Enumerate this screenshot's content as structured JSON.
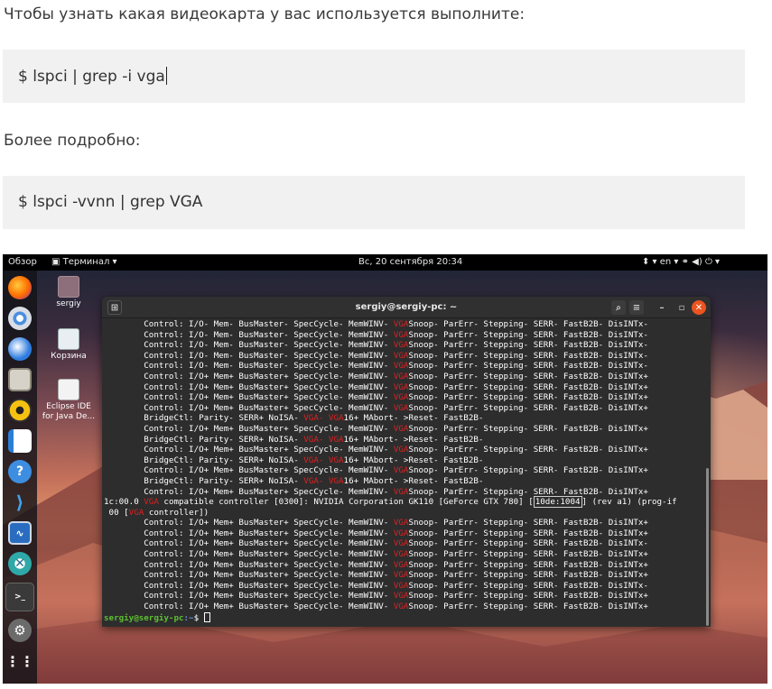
{
  "article": {
    "para1": "Чтобы узнать какая видеокарта у вас используется выполните:",
    "code1": "$  lspci | grep -i vga",
    "para2": "Более подробно:",
    "code2": "$ lspci -vvnn | grep VGA"
  },
  "topbar": {
    "overview": "Обзор",
    "app_menu": "▣ Терминал ▾",
    "clock": "Вс, 20 сентября  20:34",
    "status": "⬍ ▾     en ▾    ⚭  ◀)  ⏻ ▾"
  },
  "desktop": {
    "icons": [
      {
        "label": "sergiy",
        "icon": "home-folder-icon"
      },
      {
        "label": "Корзина",
        "icon": "trash-icon"
      },
      {
        "label": "Eclipse IDE for Java De...",
        "icon": "eclipse-launcher-icon"
      }
    ]
  },
  "dock": {
    "apps": [
      "firefox-icon",
      "chromium-icon",
      "thunderbird-icon",
      "files-icon",
      "rhythmbox-icon",
      "libreoffice-writer-icon",
      "help-icon",
      "vscode-icon",
      "system-monitor-icon",
      "remmina-icon",
      "terminal-icon",
      "settings-icon",
      "show-applications-icon"
    ]
  },
  "terminal": {
    "title": "sergiy@sergiy-pc: ~",
    "lines": [
      {
        "pre": "        Control: I/O- Mem- BusMaster- SpecCycle- MemWINV- ",
        "vga": "VGA",
        "post": "Snoop- ParErr- Stepping- SERR- FastB2B- DisINTx-"
      },
      {
        "pre": "        Control: I/O- Mem- BusMaster- SpecCycle- MemWINV- ",
        "vga": "VGA",
        "post": "Snoop- ParErr- Stepping- SERR- FastB2B- DisINTx-"
      },
      {
        "pre": "        Control: I/O- Mem- BusMaster- SpecCycle- MemWINV- ",
        "vga": "VGA",
        "post": "Snoop- ParErr- Stepping- SERR- FastB2B- DisINTx-"
      },
      {
        "pre": "        Control: I/O- Mem- BusMaster- SpecCycle- MemWINV- ",
        "vga": "VGA",
        "post": "Snoop- ParErr- Stepping- SERR- FastB2B- DisINTx-"
      },
      {
        "pre": "        Control: I/O- Mem- BusMaster- SpecCycle- MemWINV- ",
        "vga": "VGA",
        "post": "Snoop- ParErr- Stepping- SERR- FastB2B- DisINTx-"
      },
      {
        "pre": "        Control: I/O+ Mem+ BusMaster+ SpecCycle- MemWINV- ",
        "vga": "VGA",
        "post": "Snoop- ParErr- Stepping- SERR- FastB2B- DisINTx+"
      },
      {
        "pre": "        Control: I/O+ Mem+ BusMaster+ SpecCycle- MemWINV- ",
        "vga": "VGA",
        "post": "Snoop- ParErr- Stepping- SERR- FastB2B- DisINTx+"
      },
      {
        "pre": "        Control: I/O+ Mem+ BusMaster+ SpecCycle- MemWINV- ",
        "vga": "VGA",
        "post": "Snoop- ParErr- Stepping- SERR- FastB2B- DisINTx+"
      },
      {
        "pre": "        Control: I/O+ Mem+ BusMaster+ SpecCycle- MemWINV- ",
        "vga": "VGA",
        "post": "Snoop- ParErr- Stepping- SERR- FastB2B- DisINTx+"
      },
      {
        "pre": "        BridgeCtl: Parity- SERR+ NoISA- ",
        "vga": "VGA- VGA",
        "post": "16+ MAbort- >Reset- FastB2B-"
      },
      {
        "pre": "        Control: I/O+ Mem+ BusMaster+ SpecCycle- MemWINV- ",
        "vga": "VGA",
        "post": "Snoop- ParErr- Stepping- SERR- FastB2B- DisINTx+"
      },
      {
        "pre": "        BridgeCtl: Parity- SERR+ NoISA- ",
        "vga": "VGA- VGA",
        "post": "16+ MAbort- >Reset- FastB2B-"
      },
      {
        "pre": "        Control: I/O+ Mem+ BusMaster+ SpecCycle- MemWINV- ",
        "vga": "VGA",
        "post": "Snoop- ParErr- Stepping- SERR- FastB2B- DisINTx+"
      },
      {
        "pre": "        BridgeCtl: Parity- SERR+ NoISA- ",
        "vga": "VGA- VGA",
        "post": "16+ MAbort- >Reset- FastB2B-"
      },
      {
        "pre": "        Control: I/O+ Mem+ BusMaster+ SpecCycle- MemWINV- ",
        "vga": "VGA",
        "post": "Snoop- ParErr- Stepping- SERR- FastB2B- DisINTx+"
      },
      {
        "pre": "        BridgeCtl: Parity- SERR+ NoISA- ",
        "vga": "VGA- VGA",
        "post": "16+ MAbort- >Reset- FastB2B-"
      },
      {
        "pre": "        Control: I/O+ Mem+ BusMaster+ SpecCycle- MemWINV- ",
        "vga": "VGA",
        "post": "Snoop- ParErr- Stepping- SERR- FastB2B- DisINTx+"
      }
    ],
    "gpu_line": {
      "addr": "1c:00.0 ",
      "vga": "VGA",
      "mid": " compatible controller [0300]: NVIDIA Corporation GK110 [GeForce GTX 780] [",
      "id": "10de:1004",
      "post": "] (rev a1) (prog-if"
    },
    "gpu_line2": {
      "pre": " 00 [",
      "vga": "VGA",
      "post": " controller])"
    },
    "lines2": [
      {
        "pre": "        Control: I/O+ Mem+ BusMaster+ SpecCycle- MemWINV- ",
        "vga": "VGA",
        "post": "Snoop- ParErr- Stepping- SERR- FastB2B- DisINTx+"
      },
      {
        "pre": "        Control: I/O+ Mem+ BusMaster+ SpecCycle- MemWINV- ",
        "vga": "VGA",
        "post": "Snoop- ParErr- Stepping- SERR- FastB2B- DisINTx+"
      },
      {
        "pre": "        Control: I/O+ Mem+ BusMaster+ SpecCycle- MemWINV- ",
        "vga": "VGA",
        "post": "Snoop- ParErr- Stepping- SERR- FastB2B- DisINTx-"
      },
      {
        "pre": "        Control: I/O+ Mem+ BusMaster+ SpecCycle- MemWINV- ",
        "vga": "VGA",
        "post": "Snoop- ParErr- Stepping- SERR- FastB2B- DisINTx+"
      },
      {
        "pre": "        Control: I/O+ Mem+ BusMaster+ SpecCycle- MemWINV- ",
        "vga": "VGA",
        "post": "Snoop- ParErr- Stepping- SERR- FastB2B- DisINTx+"
      },
      {
        "pre": "        Control: I/O+ Mem+ BusMaster+ SpecCycle- MemWINV- ",
        "vga": "VGA",
        "post": "Snoop- ParErr- Stepping- SERR- FastB2B- DisINTx+"
      },
      {
        "pre": "        Control: I/O+ Mem+ BusMaster+ SpecCycle- MemWINV- ",
        "vga": "VGA",
        "post": "Snoop- ParErr- Stepping- SERR- FastB2B- DisINTx-"
      },
      {
        "pre": "        Control: I/O+ Mem+ BusMaster+ SpecCycle- MemWINV- ",
        "vga": "VGA",
        "post": "Snoop- ParErr- Stepping- SERR- FastB2B- DisINTx+"
      },
      {
        "pre": "        Control: I/O+ Mem+ BusMaster+ SpecCycle- MemWINV- ",
        "vga": "VGA",
        "post": "Snoop- ParErr- Stepping- SERR- FastB2B- DisINTx+"
      }
    ],
    "prompt": {
      "user": "sergiy@sergiy-pc",
      "path": ":~",
      "sign": "$ "
    }
  },
  "colors": {
    "vga_match": "#e02020",
    "prompt_user": "#5ec032",
    "prompt_path": "#6a8fd2",
    "code_bg": "#f1f1f1",
    "close_button": "#e95420"
  }
}
